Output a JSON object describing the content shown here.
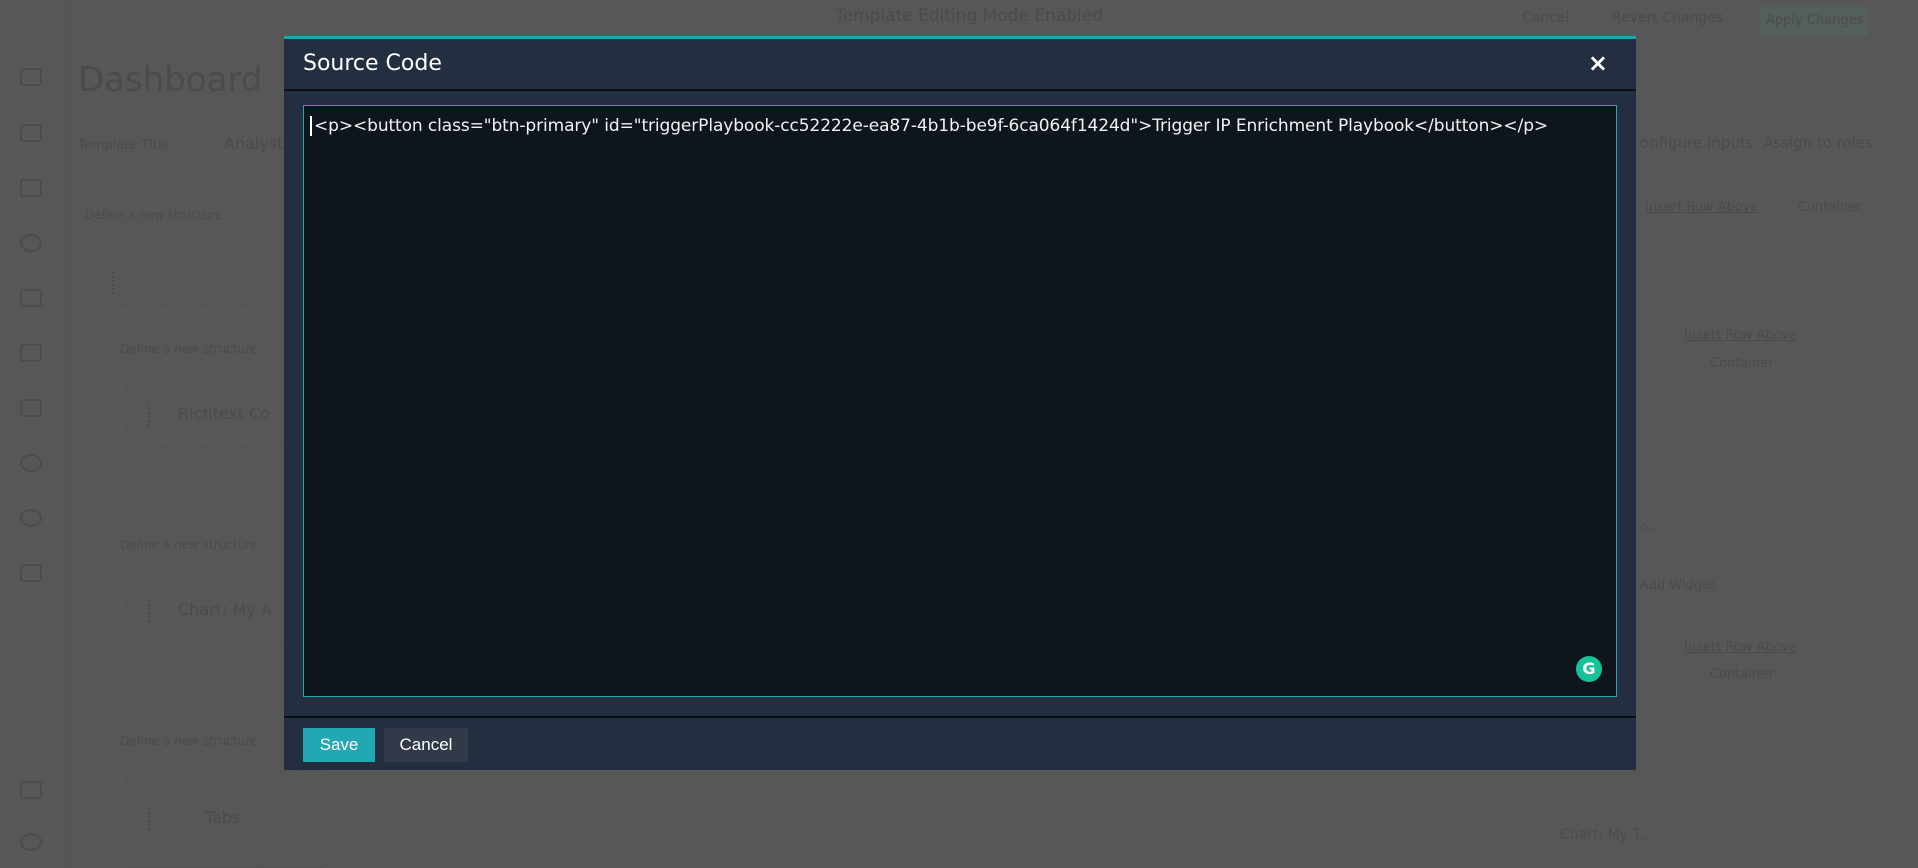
{
  "background": {
    "banner": "Template Editing Mode Enabled",
    "top_actions": {
      "cancel": "Cancel",
      "revert": "Revert Changes",
      "apply": "Apply Changes"
    },
    "page_title": "Dashboard",
    "template_title_label": "Template Title",
    "template_title_value": "Analyst",
    "define_structure": "Define a new structure",
    "widgets": [
      "Richtext Co",
      "Chart: My A",
      "Tabs"
    ],
    "right": {
      "configure_inputs": "onfigure Inputs",
      "assign_roles": "Assign to roles",
      "insert_row": "Insert Row Above",
      "container": "Container",
      "add_widget": "Add Widget",
      "widget_trunc": "o...",
      "chart_trunc": "Chart: My T..."
    }
  },
  "modal": {
    "title": "Source Code",
    "close": "×",
    "code": "<p><button class=\"btn-primary\" id=\"triggerPlaybook-cc52222e-ea87-4b1b-be9f-6ca064f1424d\">Trigger IP Enrichment Playbook</button></p>",
    "grammarly": "G",
    "save": "Save",
    "cancel": "Cancel"
  },
  "colors": {
    "accent": "#22a8b2",
    "modal_bg": "#232f40",
    "editor_bg": "#0f151d"
  }
}
